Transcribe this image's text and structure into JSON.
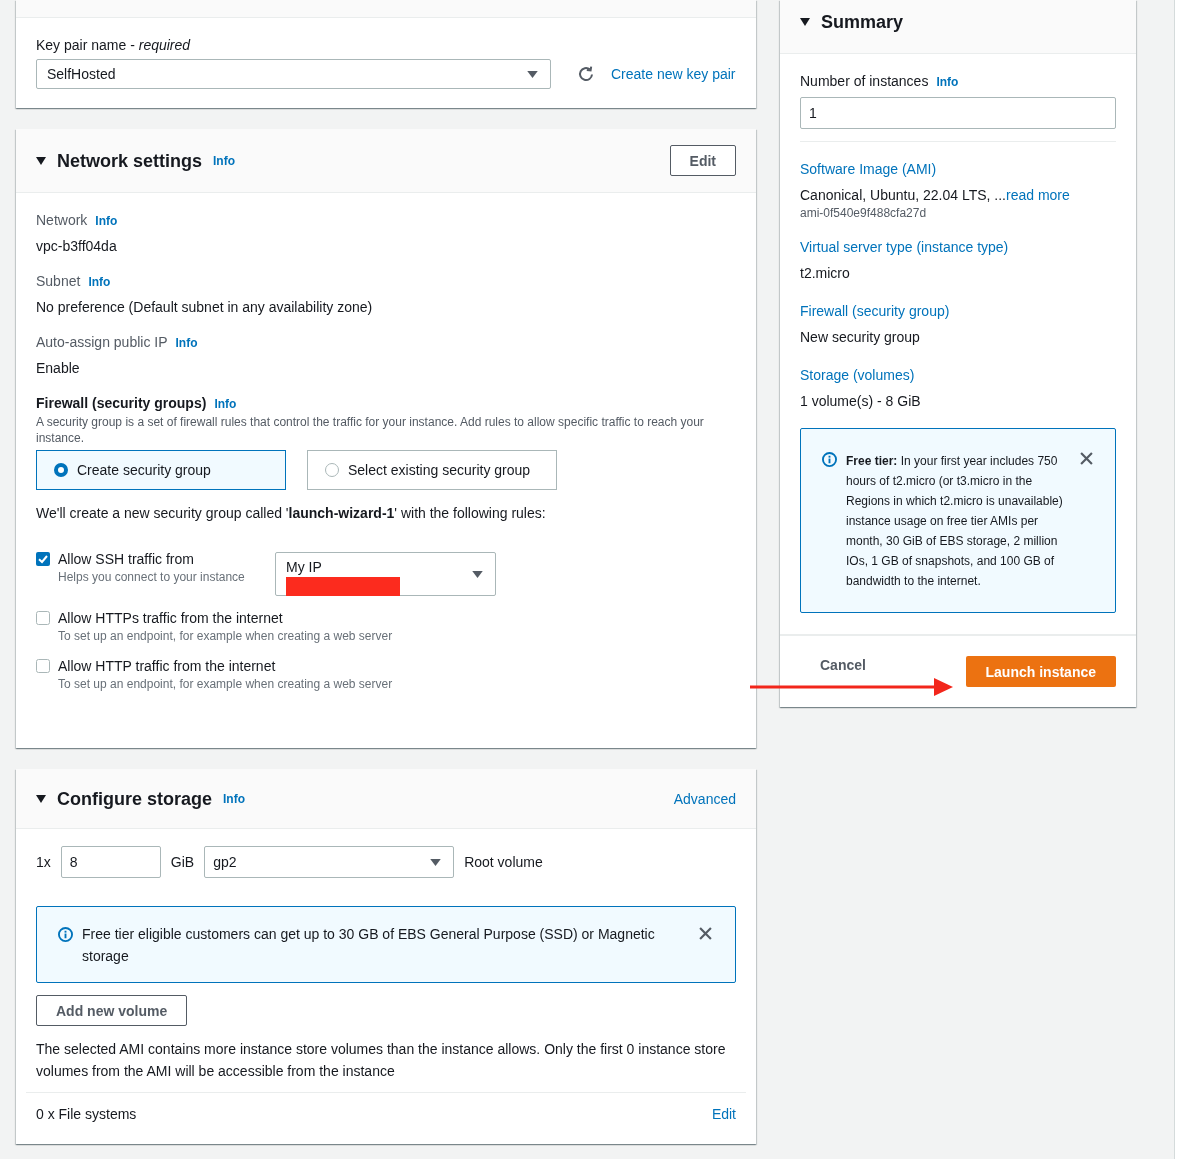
{
  "key_pair": {
    "label": "Key pair name - *required*",
    "value": "SelfHosted",
    "create_link": "Create new key pair"
  },
  "network_settings": {
    "title": "Network settings",
    "info": "Info",
    "expanded": true,
    "edit_button": "Edit",
    "fields": [
      {
        "label": "Network",
        "info": "Info",
        "value": "vpc-b3ff04da"
      },
      {
        "label": "Subnet",
        "info": "Info",
        "value": "No preference (Default subnet in any availability zone)"
      },
      {
        "label": "Auto-assign public IP",
        "info": "Info",
        "value": "Enable"
      }
    ],
    "firewall": {
      "label": "Firewall (security groups)",
      "info": "Info",
      "description": "A security group is a set of firewall rules that control the traffic for your instance. Add rules to allow specific traffic to reach your instance.",
      "options": [
        {
          "label": "Create security group",
          "selected": true
        },
        {
          "label": "Select existing security group",
          "selected": false
        }
      ],
      "note": "We'll create a new security group called '**launch-wizard-1**' with the following rules:",
      "rules": [
        {
          "label": "Allow SSH traffic from",
          "description": "Helps you connect to your instance",
          "checked": true,
          "source": {
            "value": "My IP",
            "redacted": true
          }
        },
        {
          "label": "Allow HTTPs traffic from the internet",
          "description": "To set up an endpoint, for example when creating a web server",
          "checked": false
        },
        {
          "label": "Allow HTTP traffic from the internet",
          "description": "To set up an endpoint, for example when creating a web server",
          "checked": false
        }
      ]
    }
  },
  "storage": {
    "title": "Configure storage",
    "info": "Info",
    "expanded": true,
    "advanced_link": "Advanced",
    "volumes": [
      {
        "count": "1x",
        "size": "8",
        "unit": "GiB",
        "type": "gp2",
        "label": "Root volume"
      }
    ],
    "alert": "Free tier eligible customers can get up to 30 GB of EBS General Purpose (SSD) or Magnetic storage",
    "add_button": "Add new volume",
    "note": "The selected AMI contains more instance store volumes than the instance allows. Only the first 0 instance store volumes from the AMI will be accessible from the instance",
    "file_systems": "0 x File systems",
    "edit_link": "Edit"
  },
  "summary": {
    "title": "Summary",
    "expanded": true,
    "instances": {
      "label": "Number of instances",
      "info": "Info",
      "value": "1"
    },
    "items": [
      {
        "title": "Software Image (AMI)",
        "value": "Canonical, Ubuntu, 22.04 LTS, ...",
        "more_link": "read more",
        "detail": "ami-0f540e9f488cfa27d"
      },
      {
        "title": "Virtual server type (instance type)",
        "value": "t2.micro"
      },
      {
        "title": "Firewall (security group)",
        "value": "New security group"
      },
      {
        "title": "Storage (volumes)",
        "value": "1 volume(s) - 8 GiB"
      }
    ],
    "alert": "**Free tier:** In your first year includes 750 hours of t2.micro (or t3.micro in the Regions in which t2.micro is unavailable) instance usage on free tier AMIs per month, 30 GiB of EBS storage, 2 million IOs, 1 GB of snapshots, and 100 GB of bandwidth to the internet.",
    "cancel_button": "Cancel",
    "launch_button": "Launch instance"
  }
}
